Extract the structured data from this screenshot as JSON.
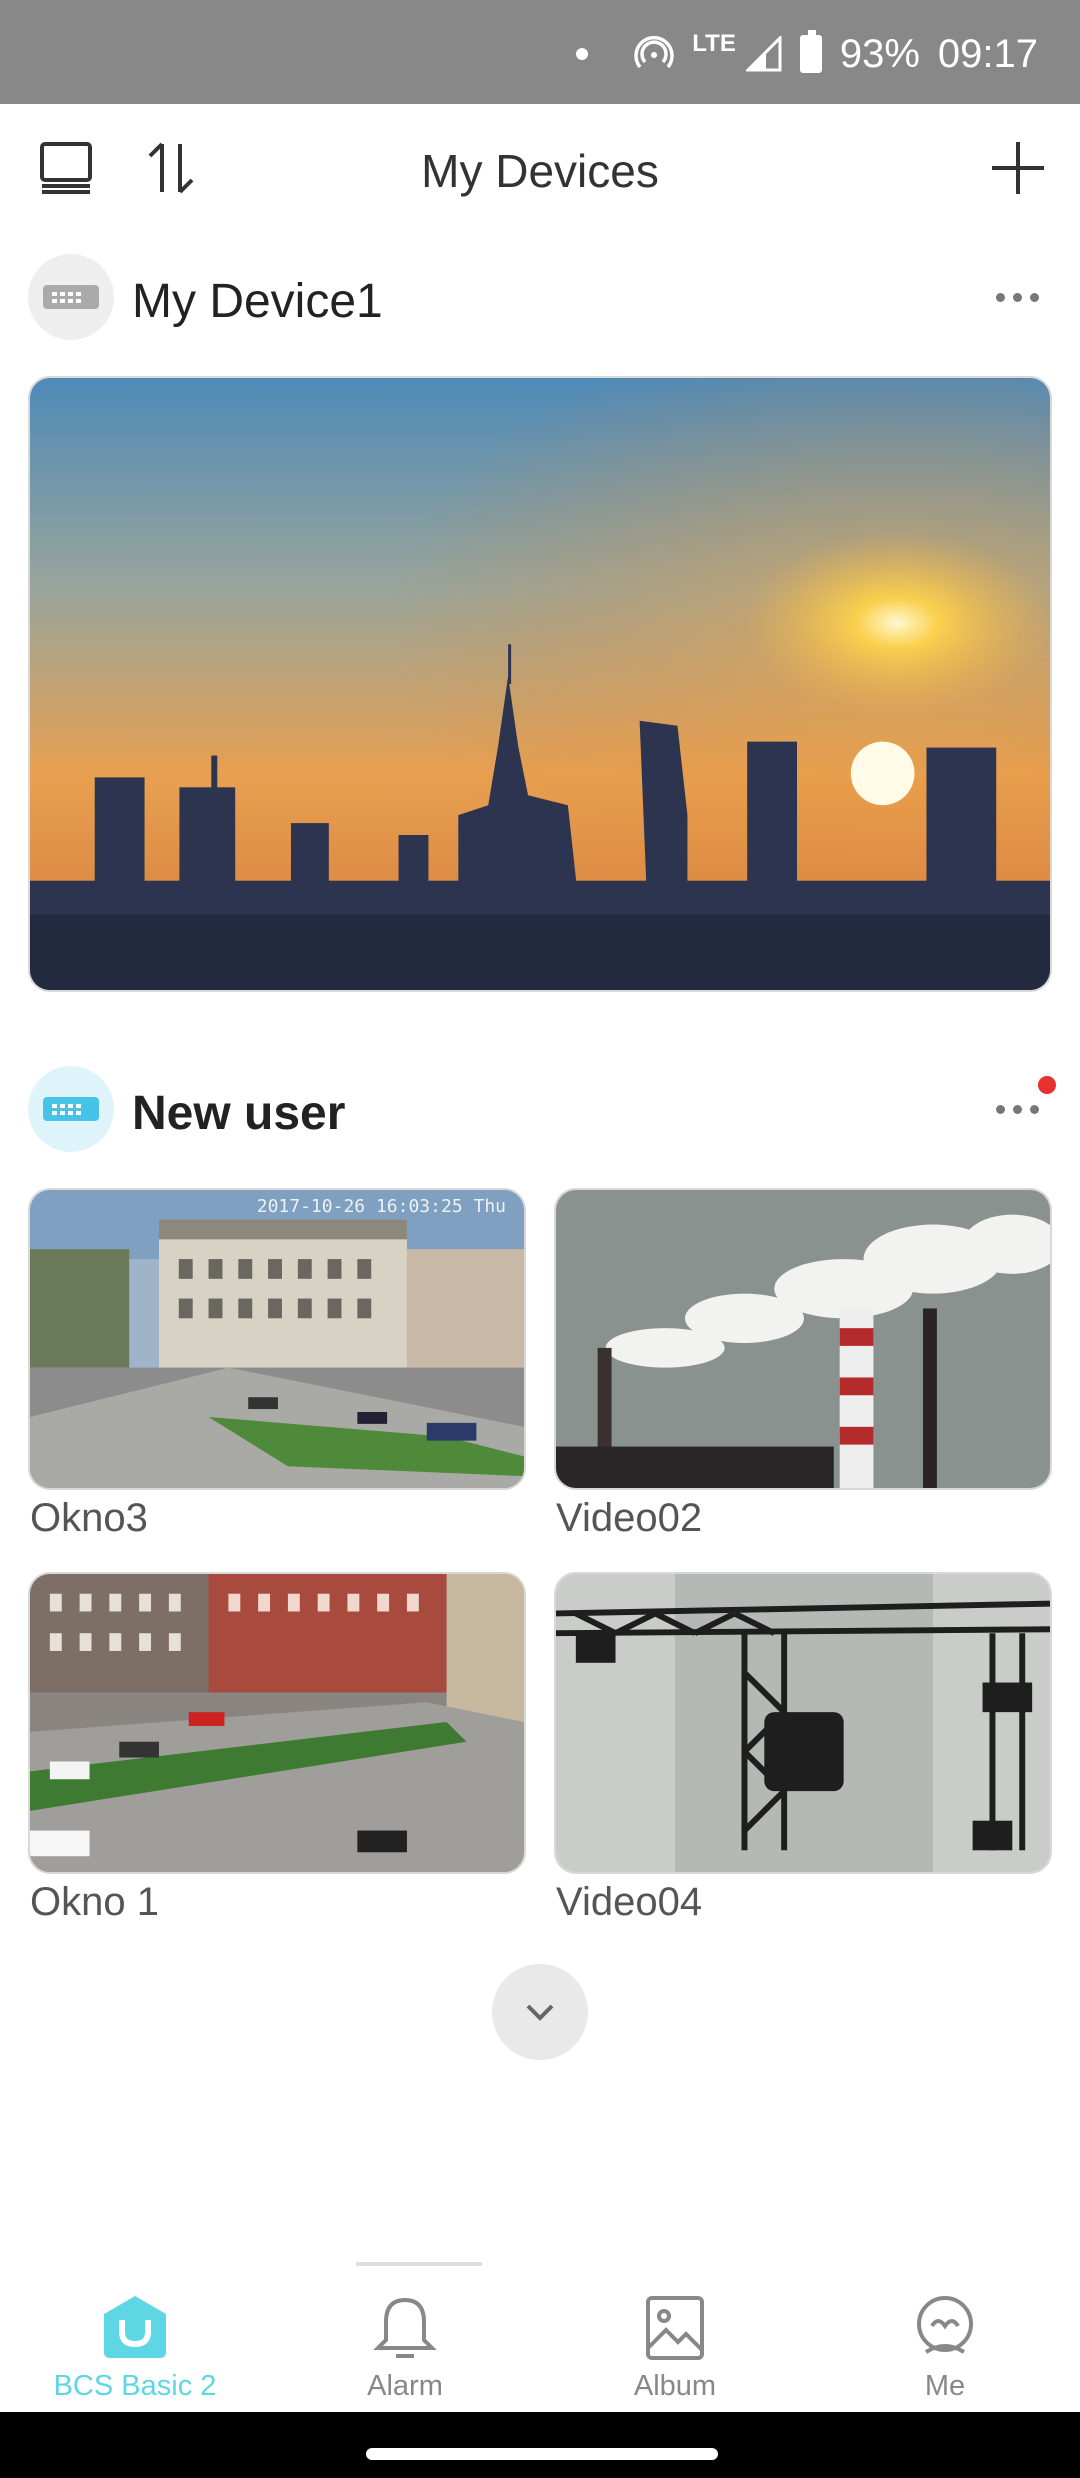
{
  "status_bar": {
    "lte": "LTE",
    "battery": "93%",
    "time": "09:17"
  },
  "header": {
    "title": "My Devices"
  },
  "devices": [
    {
      "name": "My Device1",
      "icon": "dvr-icon",
      "cameras": []
    },
    {
      "name": "New user",
      "icon": "nvr-icon",
      "has_notification": true,
      "cameras": [
        {
          "label": "Okno3",
          "overlay": "2017-10-26 16:03:25 Thu"
        },
        {
          "label": "Video02"
        },
        {
          "label": "Okno 1"
        },
        {
          "label": "Video04"
        }
      ]
    }
  ],
  "bottom_nav": [
    {
      "label": "BCS Basic 2",
      "icon": "home-icon",
      "active": true
    },
    {
      "label": "Alarm",
      "icon": "bell-icon",
      "active": false
    },
    {
      "label": "Album",
      "icon": "image-icon",
      "active": false
    },
    {
      "label": "Me",
      "icon": "user-icon",
      "active": false
    }
  ],
  "colors": {
    "accent": "#5ed6e4",
    "status_bar": "#888888",
    "notification": "#e83030"
  }
}
